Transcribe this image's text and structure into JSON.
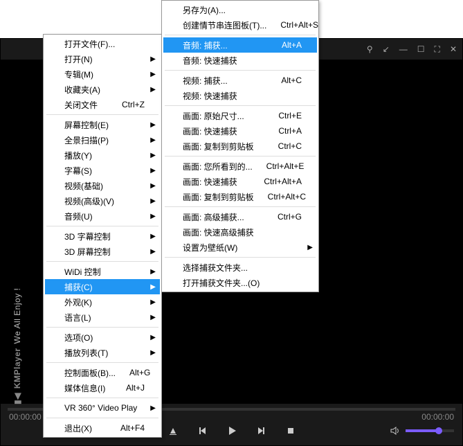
{
  "brand": {
    "name": "KMPlayer",
    "tagline": "We All Enjoy !"
  },
  "time": {
    "left": "00:00:00",
    "right": "00:00:00"
  },
  "titlebar": {
    "pin": "⚲",
    "win": "↙",
    "min": "—",
    "max": "☐",
    "full": "⛶",
    "close": "✕"
  },
  "menu1": [
    {
      "t": "item",
      "label": "打开文件(F)...",
      "arrow": false
    },
    {
      "t": "item",
      "label": "打开(N)",
      "arrow": true
    },
    {
      "t": "item",
      "label": "专辑(M)",
      "arrow": true
    },
    {
      "t": "item",
      "label": "收藏夹(A)",
      "arrow": true
    },
    {
      "t": "item",
      "label": "关闭文件",
      "shortcut": "Ctrl+Z"
    },
    {
      "t": "sep"
    },
    {
      "t": "item",
      "label": "屏幕控制(E)",
      "arrow": true
    },
    {
      "t": "item",
      "label": "全景扫描(P)",
      "arrow": true
    },
    {
      "t": "item",
      "label": "播放(Y)",
      "arrow": true
    },
    {
      "t": "item",
      "label": "字幕(S)",
      "arrow": true
    },
    {
      "t": "item",
      "label": "视频(基础)",
      "arrow": true
    },
    {
      "t": "item",
      "label": "视频(高级)(V)",
      "arrow": true
    },
    {
      "t": "item",
      "label": "音频(U)",
      "arrow": true
    },
    {
      "t": "sep"
    },
    {
      "t": "item",
      "label": "3D 字幕控制",
      "arrow": true
    },
    {
      "t": "item",
      "label": "3D 屏幕控制",
      "arrow": true
    },
    {
      "t": "sep"
    },
    {
      "t": "item",
      "label": "WiDi 控制",
      "arrow": true
    },
    {
      "t": "item",
      "label": "捕获(C)",
      "arrow": true,
      "hl": true
    },
    {
      "t": "item",
      "label": "外观(K)",
      "arrow": true
    },
    {
      "t": "item",
      "label": "语言(L)",
      "arrow": true
    },
    {
      "t": "sep"
    },
    {
      "t": "item",
      "label": "选项(O)",
      "arrow": true
    },
    {
      "t": "item",
      "label": "播放列表(T)",
      "arrow": true
    },
    {
      "t": "sep"
    },
    {
      "t": "item",
      "label": "控制面板(B)...",
      "shortcut": "Alt+G"
    },
    {
      "t": "item",
      "label": "媒体信息(I)",
      "shortcut": "Alt+J"
    },
    {
      "t": "sep"
    },
    {
      "t": "item",
      "label": "VR 360° Video Play",
      "arrow": true
    },
    {
      "t": "sep"
    },
    {
      "t": "item",
      "label": "退出(X)",
      "shortcut": "Alt+F4"
    }
  ],
  "menu2": [
    {
      "t": "item",
      "label": "另存为(A)..."
    },
    {
      "t": "item",
      "label": "创建情节串连图板(T)...",
      "shortcut": "Ctrl+Alt+S"
    },
    {
      "t": "sep"
    },
    {
      "t": "item",
      "label": "音频: 捕获...",
      "shortcut": "Alt+A",
      "hl": true
    },
    {
      "t": "item",
      "label": "音频: 快速捕获"
    },
    {
      "t": "sep"
    },
    {
      "t": "item",
      "label": "视频: 捕获...",
      "shortcut": "Alt+C"
    },
    {
      "t": "item",
      "label": "视频: 快速捕获"
    },
    {
      "t": "sep"
    },
    {
      "t": "item",
      "label": "画面: 原始尺寸...",
      "shortcut": "Ctrl+E"
    },
    {
      "t": "item",
      "label": "画面: 快速捕获",
      "shortcut": "Ctrl+A"
    },
    {
      "t": "item",
      "label": "画面: 复制到剪贴板",
      "shortcut": "Ctrl+C"
    },
    {
      "t": "sep"
    },
    {
      "t": "item",
      "label": "画面: 您所看到的...",
      "shortcut": "Ctrl+Alt+E"
    },
    {
      "t": "item",
      "label": "画面: 快速捕获",
      "shortcut": "Ctrl+Alt+A"
    },
    {
      "t": "item",
      "label": "画面: 复制到剪贴板",
      "shortcut": "Ctrl+Alt+C"
    },
    {
      "t": "sep"
    },
    {
      "t": "item",
      "label": "画面: 高级捕获...",
      "shortcut": "Ctrl+G"
    },
    {
      "t": "item",
      "label": "画面: 快速高级捕获"
    },
    {
      "t": "item",
      "label": "设置为壁纸(W)",
      "arrow": true
    },
    {
      "t": "sep"
    },
    {
      "t": "item",
      "label": "选择捕获文件夹..."
    },
    {
      "t": "item",
      "label": "打开捕获文件夹...(O)"
    }
  ]
}
